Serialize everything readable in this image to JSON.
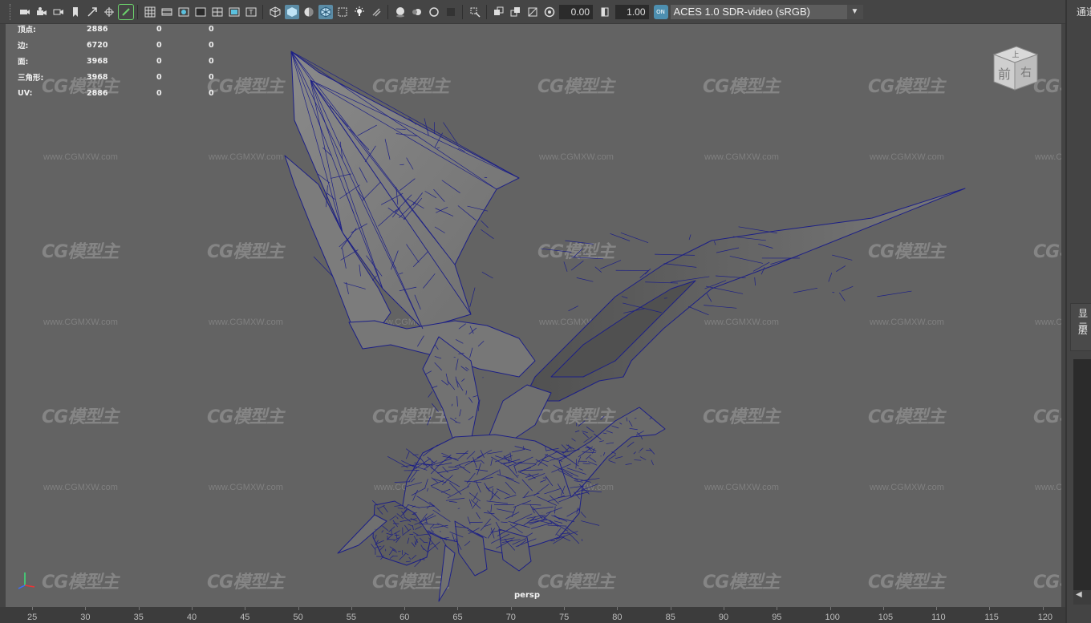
{
  "toolbar": {
    "exposure_value": "0.00",
    "gamma_value": "1.00",
    "color_space": "ACES 1.0 SDR-video (sRGB)",
    "icons": [
      "camera-select",
      "camera-attributes",
      "bookmark",
      "image-plane",
      "grid",
      "film-gate",
      "resolution-gate",
      "gate-mask",
      "field-chart",
      "safe-action",
      "safe-title",
      "wireframe",
      "smooth-shade",
      "default-material",
      "wireframe-on-shaded",
      "xray",
      "use-all-lights",
      "shadows",
      "screen-space-ao",
      "motion-blur",
      "anti-aliasing",
      "depth-of-field",
      "isolate-select",
      "xray-joints",
      "xray-active",
      "backface-culling",
      "exposure",
      "gamma",
      "color-management"
    ]
  },
  "hud": {
    "rows": [
      {
        "label": "顶点:",
        "v1": "2886",
        "v2": "0",
        "v3": "0"
      },
      {
        "label": "边:",
        "v1": "6720",
        "v2": "0",
        "v3": "0"
      },
      {
        "label": "面:",
        "v1": "3968",
        "v2": "0",
        "v3": "0"
      },
      {
        "label": "三角形:",
        "v1": "3968",
        "v2": "0",
        "v3": "0"
      },
      {
        "label": "UV:",
        "v1": "2886",
        "v2": "0",
        "v3": "0"
      }
    ]
  },
  "viewcube": {
    "top": "上",
    "front": "前",
    "right": "右"
  },
  "viewport": {
    "camera_name": "persp"
  },
  "watermark": {
    "logo": "CG模型主",
    "url": "www.CGMXW.com"
  },
  "timeline": {
    "ticks": [
      "25",
      "30",
      "35",
      "40",
      "45",
      "50",
      "55",
      "60",
      "65",
      "70",
      "75",
      "80",
      "85",
      "90",
      "95",
      "100",
      "105",
      "110",
      "115",
      "120"
    ]
  },
  "right_panel": {
    "channels": "通道",
    "display": "显示",
    "layers": "层"
  },
  "colors": {
    "viewport_bg": "#636363",
    "wire": "#1c1f86",
    "accent": "#5b8ca6"
  }
}
